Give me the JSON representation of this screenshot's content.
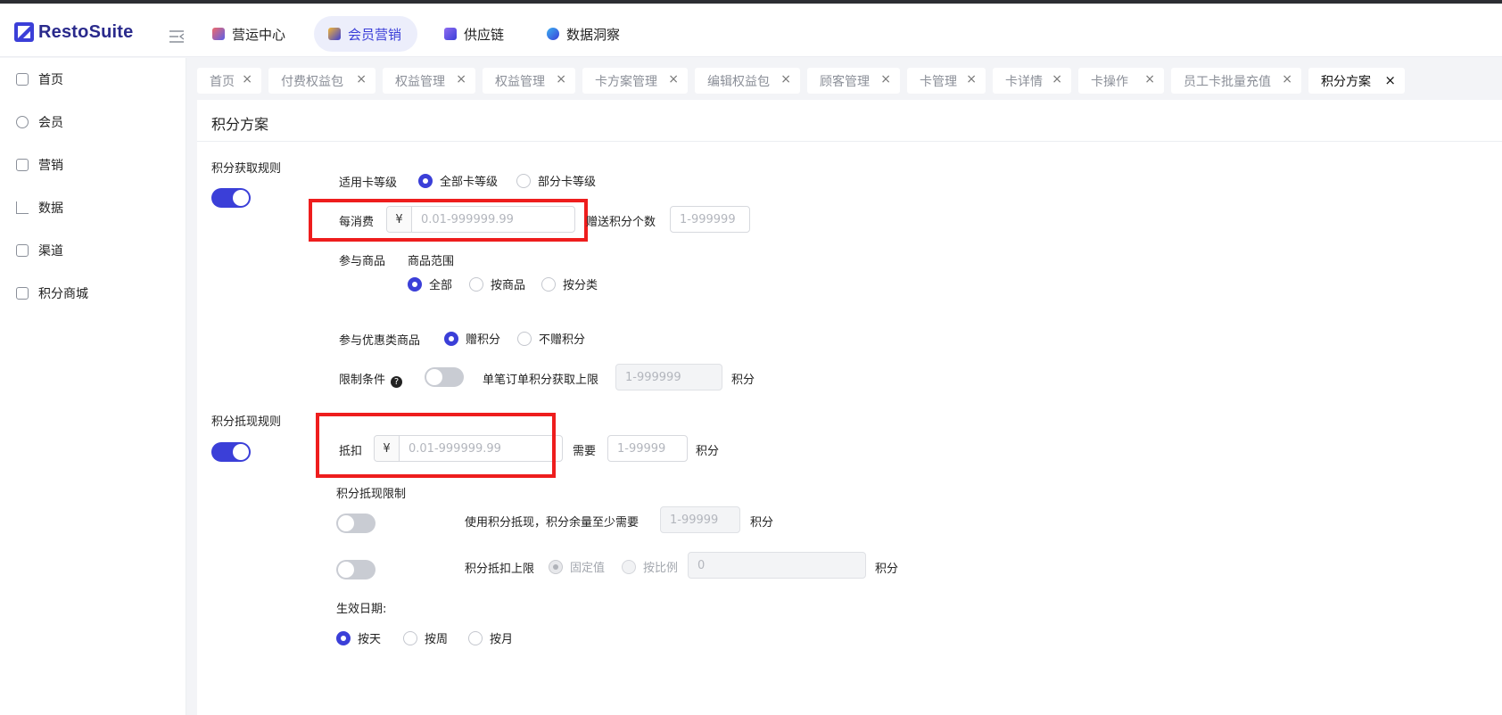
{
  "app": {
    "name": "RestoSuite"
  },
  "nav": {
    "items": [
      {
        "label": "营运中心",
        "icon": "operations-icon",
        "color": "#5b5fe8"
      },
      {
        "label": "会员营销",
        "icon": "member-marketing-icon",
        "color": "#3b3fd8",
        "active": true
      },
      {
        "label": "供应链",
        "icon": "supply-chain-icon",
        "color": "#5b5fe8"
      },
      {
        "label": "数据洞察",
        "icon": "data-insight-icon",
        "color": "#3b8ef0"
      }
    ]
  },
  "sidebar": {
    "items": [
      {
        "label": "首页",
        "icon": "home-icon"
      },
      {
        "label": "会员",
        "icon": "member-icon"
      },
      {
        "label": "营销",
        "icon": "marketing-icon"
      },
      {
        "label": "数据",
        "icon": "chart-icon"
      },
      {
        "label": "渠道",
        "icon": "channel-icon"
      },
      {
        "label": "积分商城",
        "icon": "points-mall-icon"
      }
    ]
  },
  "tabs": [
    {
      "label": "首页",
      "close": "×"
    },
    {
      "label": "付费权益包",
      "close": "×"
    },
    {
      "label": "权益管理",
      "close": "×"
    },
    {
      "label": "权益管理",
      "close": "×"
    },
    {
      "label": "卡方案管理",
      "close": "×"
    },
    {
      "label": "编辑权益包",
      "close": "×"
    },
    {
      "label": "顾客管理",
      "close": "×"
    },
    {
      "label": "卡管理",
      "close": "×"
    },
    {
      "label": "卡详情",
      "close": "×"
    },
    {
      "label": "卡操作",
      "close": "×"
    },
    {
      "label": "员工卡批量充值",
      "close": "×"
    },
    {
      "label": "积分方案",
      "close": "×",
      "active": true
    }
  ],
  "page": {
    "title": "积分方案",
    "earn": {
      "section_label": "积分获取规则",
      "toggle_on": true,
      "card_level_label": "适用卡等级",
      "card_level_options": [
        "全部卡等级",
        "部分卡等级"
      ],
      "card_level_selected": "全部卡等级",
      "per_spend_label": "每消费",
      "currency": "¥",
      "spend_placeholder": "0.01-999999.99",
      "gift_points_label": "赠送积分个数",
      "gift_points_placeholder": "1-999999",
      "goods_label": "参与商品",
      "goods_scope_label": "商品范围",
      "goods_scope_options": [
        "全部",
        "按商品",
        "按分类"
      ],
      "goods_scope_selected": "全部",
      "promo_goods_label": "参与优惠类商品",
      "promo_goods_options": [
        "赠积分",
        "不赠积分"
      ],
      "promo_goods_selected": "赠积分",
      "limit_label": "限制条件",
      "limit_help": "?",
      "limit_toggle_on": false,
      "order_cap_label": "单笔订单积分获取上限",
      "order_cap_placeholder": "1-999999",
      "points_unit": "积分"
    },
    "redeem": {
      "section_label": "积分抵现规则",
      "toggle_on": true,
      "deduct_label": "抵扣",
      "currency": "¥",
      "deduct_placeholder": "0.01-999999.99",
      "need_label": "需要",
      "need_placeholder": "1-99999",
      "points_unit": "积分",
      "limit_title": "积分抵现限制",
      "min_balance_toggle_on": false,
      "min_balance_label": "使用积分抵现，积分余量至少需要",
      "min_balance_placeholder": "1-99999",
      "cap_toggle_on": false,
      "cap_label": "积分抵扣上限",
      "cap_options": [
        "固定值",
        "按比例"
      ],
      "cap_selected": "固定值",
      "cap_placeholder": "0",
      "effective_label": "生效日期:",
      "effective_options": [
        "按天",
        "按周",
        "按月"
      ],
      "effective_selected": "按天"
    }
  },
  "colors": {
    "accent": "#3b3fd8",
    "highlight": "#ee1d1d"
  }
}
